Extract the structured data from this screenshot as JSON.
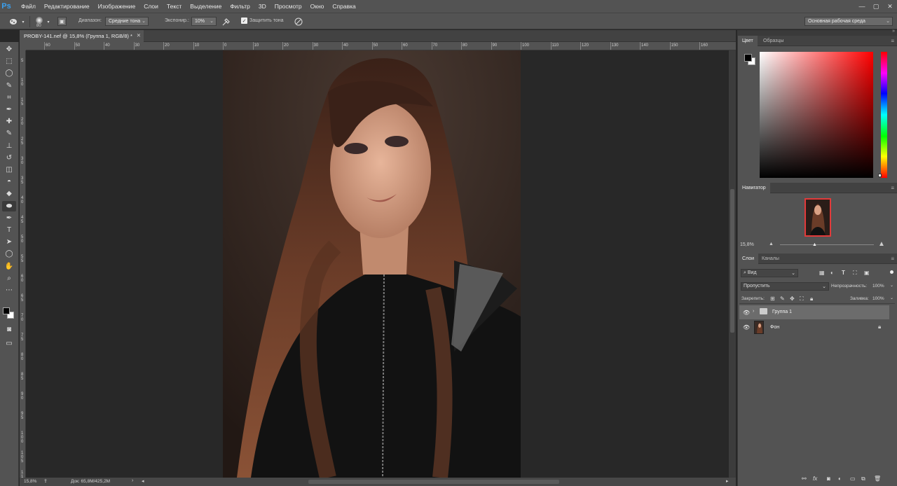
{
  "app": {
    "logo": "Ps",
    "accent": "#3aa0f0"
  },
  "menu": [
    "Файл",
    "Редактирование",
    "Изображение",
    "Слои",
    "Текст",
    "Выделение",
    "Фильтр",
    "3D",
    "Просмотр",
    "Окно",
    "Справка"
  ],
  "options": {
    "brush_size": "80",
    "range_label": "Диапазон:",
    "range_value": "Средние тона",
    "exposure_label": "Экспонир.:",
    "exposure_value": "10%",
    "protect_label": "Защитить тона",
    "workspace": "Основная рабочая среда"
  },
  "document": {
    "tab_title": "PROBY-141.nef @ 15,8% (Группа 1, RGB/8) *"
  },
  "ruler": {
    "top": [
      "60",
      "50",
      "40",
      "30",
      "20",
      "10",
      "0",
      "10",
      "20",
      "30",
      "40",
      "50",
      "60",
      "70",
      "80",
      "90",
      "100",
      "110",
      "120",
      "130",
      "140",
      "150",
      "160"
    ],
    "left": [
      "5",
      "1\n0",
      "1\n5",
      "2\n0",
      "2\n5",
      "3\n0",
      "3\n5",
      "4\n0",
      "4\n5",
      "5\n0",
      "5\n5",
      "6\n0",
      "6\n5",
      "7\n0",
      "7\n5",
      "8\n0",
      "8\n5",
      "9\n0",
      "9\n5",
      "1\n0\n0",
      "1\n0\n5",
      "1\n1\n0"
    ]
  },
  "status": {
    "zoom": "15,8%",
    "doc": "Док: 65,8M/425,2M"
  },
  "panels": {
    "color": {
      "tab_active": "Цвет",
      "tab_other": "Образцы"
    },
    "navigator": {
      "tab": "Навигатор",
      "zoom": "15,8%"
    },
    "layers": {
      "tab_active": "Слои",
      "tab_other": "Каналы",
      "filter_kind": "Вид",
      "blend_mode": "Пропустить",
      "opacity_label": "Непрозрачность:",
      "opacity_value": "100%",
      "lock_label": "Закрепить:",
      "fill_label": "Заливка:",
      "fill_value": "100%",
      "items": [
        {
          "name": "Группа 1",
          "type": "group"
        },
        {
          "name": "Фон",
          "type": "background"
        }
      ]
    }
  }
}
